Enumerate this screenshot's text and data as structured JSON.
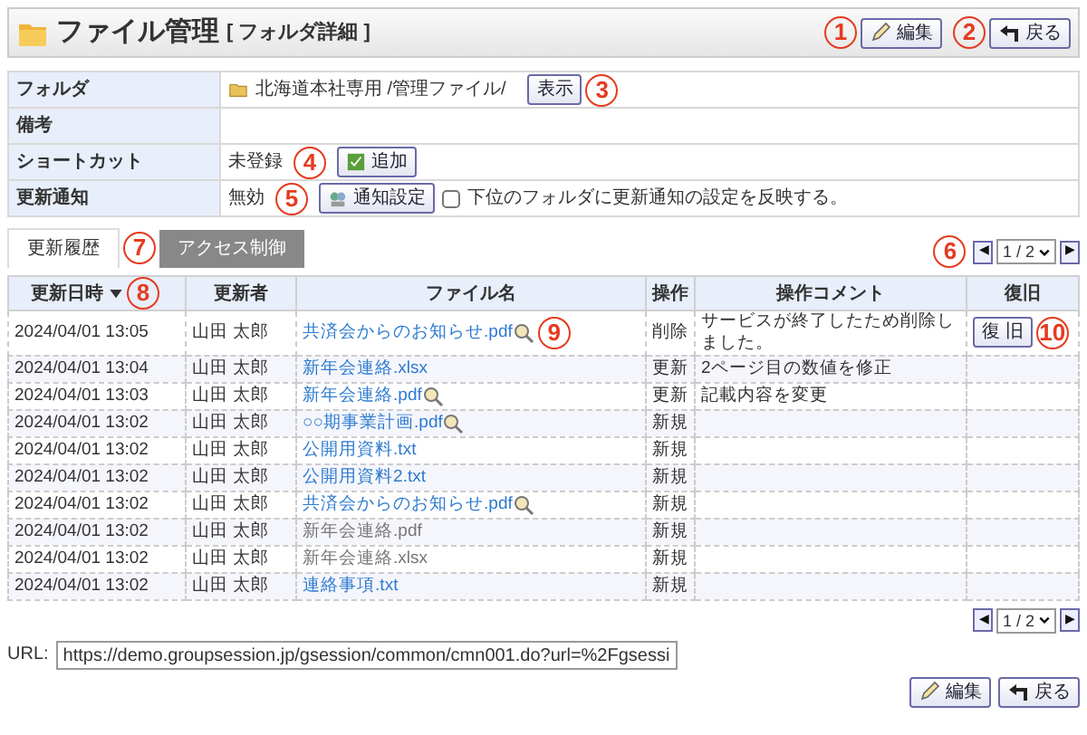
{
  "header": {
    "title": "ファイル管理",
    "subtitle": "[ フォルダ詳細 ]",
    "buttons": [
      {
        "label": "編集",
        "callout": "1"
      },
      {
        "label": "戻る",
        "callout": "2"
      }
    ]
  },
  "info": {
    "folder_label": "フォルダ",
    "folder_path": "北海道本社専用 /管理ファイル/",
    "show_button": {
      "label": "表示",
      "callout": "3"
    },
    "note_label": "備考",
    "shortcut_label": "ショートカット",
    "shortcut_status": "未登録",
    "add_button": {
      "label": "追加",
      "callout": "4"
    },
    "notify_label": "更新通知",
    "notify_status": "無効",
    "notify_button": {
      "label": "通知設定",
      "callout": "5"
    },
    "reflect_checkbox": {
      "label": "下位のフォルダに更新通知の設定を反映する。",
      "checked": false
    }
  },
  "tabs": [
    {
      "label": "更新履歴",
      "selected": true,
      "callout": "7"
    },
    {
      "label": "アクセス制御",
      "selected": false
    }
  ],
  "pager_top": {
    "prev": "◀",
    "page": "1 / 2",
    "next": "▶",
    "callout": "6"
  },
  "table": {
    "columns": [
      {
        "label": "更新日時",
        "sorted": true,
        "callout": "8"
      },
      {
        "label": "更新者"
      },
      {
        "label": "ファイル名"
      },
      {
        "label": "操作"
      },
      {
        "label": "操作コメント"
      },
      {
        "label": "復旧"
      }
    ],
    "rows": [
      {
        "date": "2024/04/01 13:05",
        "user": "山田 太郎",
        "file": "共済会からのお知らせ.pdf",
        "linked": true,
        "preview": true,
        "op": "削除",
        "comment": "サービスが終了したため削除しました。",
        "restore": "復 旧",
        "callout": "9",
        "restore_callout": "10"
      },
      {
        "date": "2024/04/01 13:04",
        "user": "山田 太郎",
        "file": "新年会連絡.xlsx",
        "linked": true,
        "preview": false,
        "op": "更新",
        "comment": "2ページ目の数値を修正"
      },
      {
        "date": "2024/04/01 13:03",
        "user": "山田 太郎",
        "file": "新年会連絡.pdf",
        "linked": true,
        "preview": true,
        "op": "更新",
        "comment": "記載内容を変更"
      },
      {
        "date": "2024/04/01 13:02",
        "user": "山田 太郎",
        "file": "○○期事業計画.pdf",
        "linked": true,
        "preview": true,
        "op": "新規"
      },
      {
        "date": "2024/04/01 13:02",
        "user": "山田 太郎",
        "file": "公開用資料.txt",
        "linked": true,
        "preview": false,
        "op": "新規"
      },
      {
        "date": "2024/04/01 13:02",
        "user": "山田 太郎",
        "file": "公開用資料2.txt",
        "linked": true,
        "preview": false,
        "op": "新規"
      },
      {
        "date": "2024/04/01 13:02",
        "user": "山田 太郎",
        "file": "共済会からのお知らせ.pdf",
        "linked": true,
        "preview": true,
        "op": "新規"
      },
      {
        "date": "2024/04/01 13:02",
        "user": "山田 太郎",
        "file": "新年会連絡.pdf",
        "linked": false,
        "preview": false,
        "op": "新規"
      },
      {
        "date": "2024/04/01 13:02",
        "user": "山田 太郎",
        "file": "新年会連絡.xlsx",
        "linked": false,
        "preview": false,
        "op": "新規"
      },
      {
        "date": "2024/04/01 13:02",
        "user": "山田 太郎",
        "file": "連絡事項.txt",
        "linked": true,
        "preview": false,
        "op": "新規"
      }
    ]
  },
  "pager_bottom": {
    "prev": "◀",
    "page": "1 / 2",
    "next": "▶"
  },
  "url": {
    "label": "URL:",
    "value": "https://demo.groupsession.jp/gsession/common/cmn001.do?url=%2Fgsessi"
  },
  "footer_buttons": [
    {
      "label": "編集"
    },
    {
      "label": "戻る"
    }
  ]
}
